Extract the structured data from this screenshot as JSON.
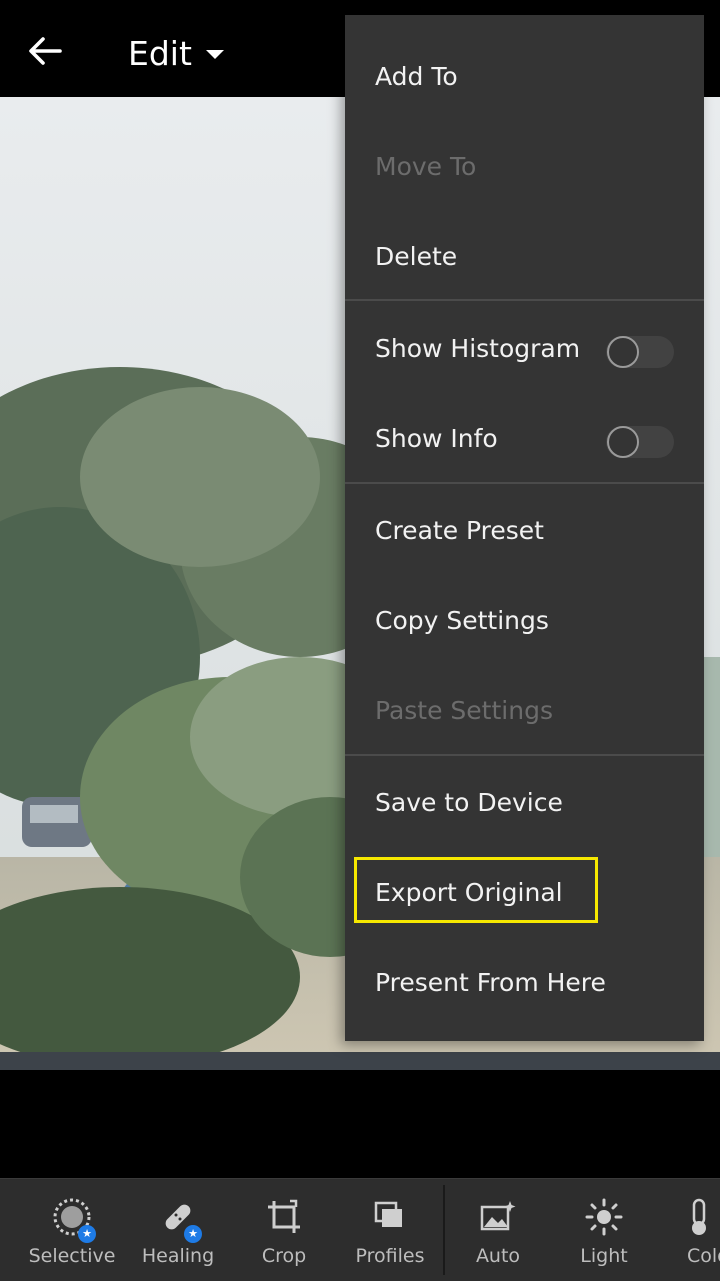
{
  "header": {
    "back_icon": "arrow-left-icon",
    "title": "Edit",
    "dropdown_icon": "caret-down-icon"
  },
  "menu": {
    "items": [
      {
        "label": "Add To",
        "enabled": true
      },
      {
        "label": "Move To",
        "enabled": false
      },
      {
        "label": "Delete",
        "enabled": true
      },
      {
        "label": "Show Histogram",
        "enabled": true,
        "toggle": false
      },
      {
        "label": "Show Info",
        "enabled": true,
        "toggle": false
      },
      {
        "label": "Create Preset",
        "enabled": true
      },
      {
        "label": "Copy Settings",
        "enabled": true
      },
      {
        "label": "Paste Settings",
        "enabled": false
      },
      {
        "label": "Save to Device",
        "enabled": true
      },
      {
        "label": "Export Original",
        "enabled": true,
        "highlighted": true
      },
      {
        "label": "Present From Here",
        "enabled": true
      }
    ],
    "highlight_color": "#f6e800"
  },
  "toolbar": {
    "tools": [
      {
        "label": "Selective",
        "icon": "selective-mask-icon",
        "premium": true
      },
      {
        "label": "Healing",
        "icon": "bandage-icon",
        "premium": true
      },
      {
        "label": "Crop",
        "icon": "crop-icon",
        "premium": false
      },
      {
        "label": "Profiles",
        "icon": "profiles-icon",
        "premium": false
      },
      {
        "label": "Auto",
        "icon": "auto-image-icon",
        "premium": false
      },
      {
        "label": "Light",
        "icon": "sun-icon",
        "premium": false
      },
      {
        "label": "Colo",
        "icon": "thermometer-icon",
        "premium": false
      }
    ],
    "premium_badge_color": "#1e7be6"
  }
}
